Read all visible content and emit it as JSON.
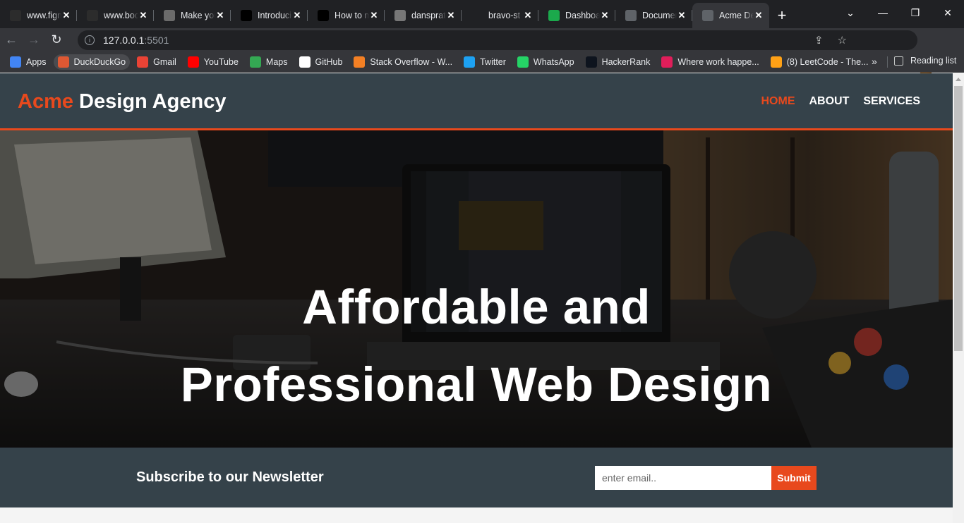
{
  "browser": {
    "tabs": [
      {
        "title": "www.figma.com",
        "icon": "figma-icon",
        "color": "#2c2c2c"
      },
      {
        "title": "www.bootstrap",
        "icon": "bootstrap-icon",
        "color": "#2c2c2c"
      },
      {
        "title": "Make your",
        "icon": "avatar-icon",
        "color": "#6b6b6b"
      },
      {
        "title": "Introducing",
        "icon": "dev-icon",
        "color": "#000000"
      },
      {
        "title": "How to make",
        "icon": "dev-icon",
        "color": "#000000"
      },
      {
        "title": "dansprat",
        "icon": "avatar-icon",
        "color": "#777777"
      },
      {
        "title": "bravo-st",
        "icon": "github-icon",
        "color": "#202124"
      },
      {
        "title": "Dashboard",
        "icon": "hackerrank-icon",
        "color": "#1ba94c"
      },
      {
        "title": "Document",
        "icon": "globe-icon",
        "color": "#5f6368"
      },
      {
        "title": "Acme Design",
        "icon": "globe-icon",
        "color": "#5f6368"
      }
    ],
    "url_host": "127.0.0.1",
    "url_port": ":5501",
    "bookmarks": [
      {
        "label": "Apps",
        "icon": "apps-grid-icon",
        "color": "#4285f4"
      },
      {
        "label": "DuckDuckGo",
        "icon": "duckduckgo-icon",
        "color": "#de5833"
      },
      {
        "label": "Gmail",
        "icon": "gmail-icon",
        "color": "#ea4335"
      },
      {
        "label": "YouTube",
        "icon": "youtube-icon",
        "color": "#ff0000"
      },
      {
        "label": "Maps",
        "icon": "maps-icon",
        "color": "#34a853"
      },
      {
        "label": "GitHub",
        "icon": "github-icon",
        "color": "#ffffff"
      },
      {
        "label": "Stack Overflow - W...",
        "icon": "stackoverflow-icon",
        "color": "#f48024"
      },
      {
        "label": "Twitter",
        "icon": "twitter-icon",
        "color": "#1da1f2"
      },
      {
        "label": "WhatsApp",
        "icon": "whatsapp-icon",
        "color": "#25d366"
      },
      {
        "label": "HackerRank",
        "icon": "hackerrank-icon",
        "color": "#0e141e"
      },
      {
        "label": "Where work happe...",
        "icon": "slack-icon",
        "color": "#e01e5a"
      },
      {
        "label": "(8) LeetCode - The...",
        "icon": "leetcode-icon",
        "color": "#ffa116"
      }
    ],
    "more_bookmarks": "»",
    "reading_list": "Reading list"
  },
  "site": {
    "logo_highlight": "Acme",
    "logo_rest": " Design Agency",
    "nav": [
      "HOME",
      "ABOUT",
      "SERVICES"
    ],
    "hero_line1": "Affordable and",
    "hero_line2": "Professional Web Design",
    "newsletter_heading": "Subscribe to our Newsletter",
    "email_placeholder": "enter email..",
    "submit_label": "Submit"
  },
  "colors": {
    "accent": "#e8491d",
    "header_bg": "#35424a",
    "text_light": "#ffffff"
  }
}
